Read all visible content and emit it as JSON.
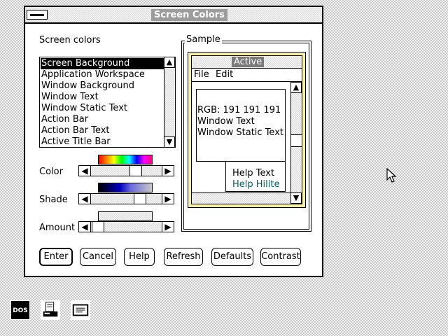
{
  "dialog": {
    "title": "Screen Colors"
  },
  "screen_colors": {
    "label": "Screen colors",
    "items": [
      {
        "label": "Screen Background",
        "selected": true
      },
      {
        "label": "Application Workspace"
      },
      {
        "label": "Window Background"
      },
      {
        "label": "Window Text"
      },
      {
        "label": "Window Static Text"
      },
      {
        "label": "Action Bar"
      },
      {
        "label": "Action Bar Text"
      },
      {
        "label": "Active Title Bar"
      }
    ]
  },
  "controls": {
    "color_label": "Color",
    "shade_label": "Shade",
    "amount_label": "Amount"
  },
  "sample": {
    "label": "Sample",
    "title": "Active",
    "menu_file": "File",
    "menu_edit": "Edit",
    "rgb": "RGB: 191 191 191",
    "window_text": "Window Text",
    "window_static_text": "Window Static Text",
    "help_text": "Help Text",
    "help_hilite": "Help Hilite"
  },
  "buttons": {
    "enter": "Enter",
    "cancel": "Cancel",
    "help": "Help",
    "refresh": "Refresh",
    "defaults": "Defaults",
    "contrast": "Contrast"
  },
  "desktop": {
    "dos_icon_label": "DOS"
  },
  "colors": {
    "help_hilite": "#006060",
    "sample_frame": "#f5efa8",
    "title_bg": "#9c9c9c"
  }
}
